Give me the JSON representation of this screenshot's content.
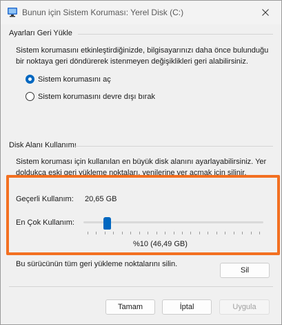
{
  "window": {
    "title": "Bunun için Sistem Koruması: Yerel Disk (C:)",
    "close_glyph": "✕",
    "accent_color": "#0067c0",
    "highlight_color": "#f37021"
  },
  "restore_settings": {
    "section_title": "Ayarları Geri Yükle",
    "description_line1": "Sistem korumasını etkinleştirdiğinizde, bilgisayarınızı daha önce bulunduğu",
    "description_line2": "bir noktaya geri döndürerek istenmeyen değişiklikleri geri alabilirsiniz.",
    "options": [
      {
        "label": "Sistem korumasını aç",
        "selected": true
      },
      {
        "label": "Sistem korumasını devre dışı bırak",
        "selected": false
      }
    ]
  },
  "disk_usage": {
    "section_title": "Disk Alanı Kullanımı",
    "description_line1": "Sistem koruması için kullanılan en büyük disk alanını ayarlayabilirsiniz. Yer",
    "description_line2": "doldukça eski geri yükleme noktaları, yenilerine yer açmak için silinir.",
    "current_usage_label": "Geçerli Kullanım:",
    "current_usage_value": "20,65 GB",
    "max_usage_label": "En Çok Kullanım:",
    "max_usage_percent": "%10 (46,49 GB)",
    "slider_value_fraction": 0.1,
    "delete_text": "Bu sürücünün tüm geri yükleme noktalarını silin.",
    "delete_button": "Sil"
  },
  "footer": {
    "ok_button": "Tamam",
    "cancel_button": "İptal",
    "apply_button": "Uygula"
  }
}
